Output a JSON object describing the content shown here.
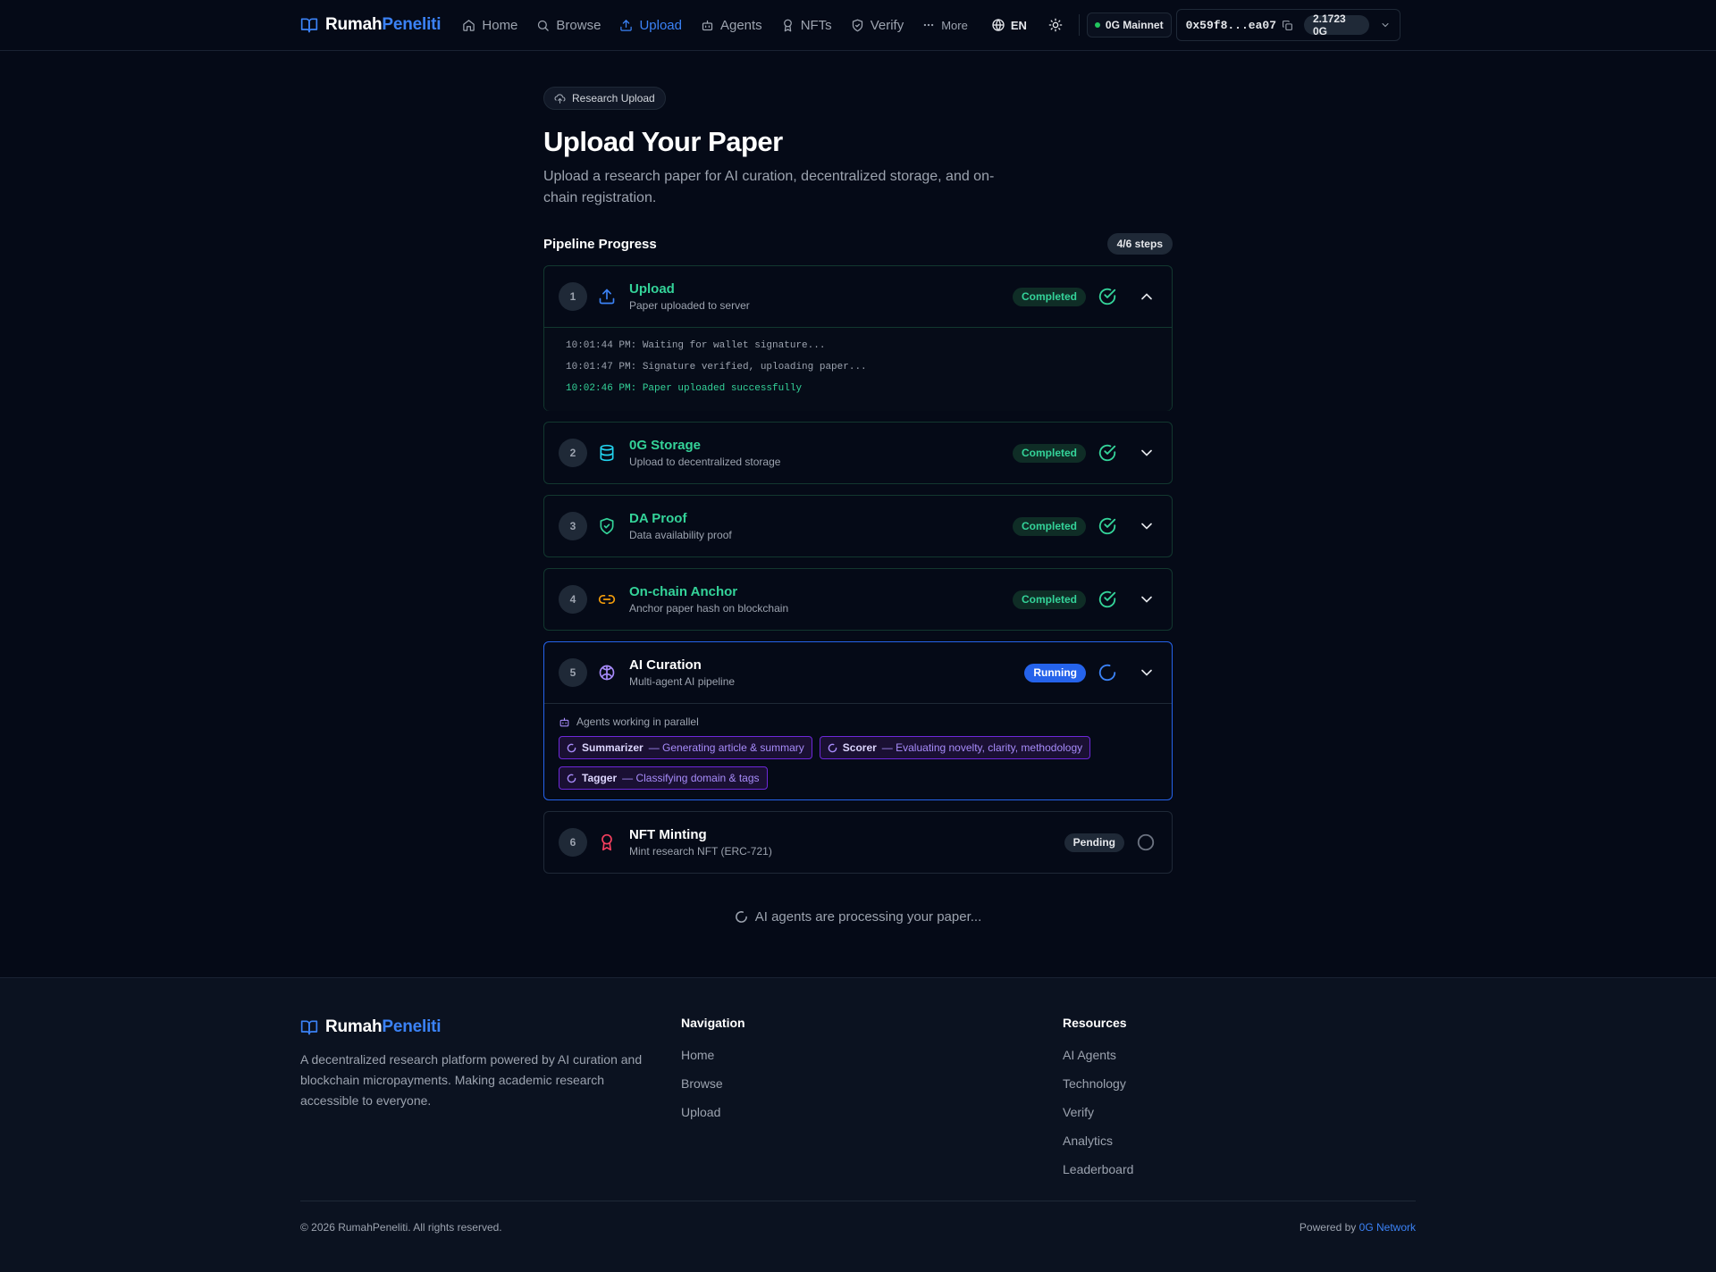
{
  "nav": {
    "brand_a": "Rumah",
    "brand_b": "Peneliti",
    "links": [
      {
        "label": "Home",
        "icon": "home-icon"
      },
      {
        "label": "Browse",
        "icon": "search-icon"
      },
      {
        "label": "Upload",
        "icon": "upload-icon",
        "active": true
      },
      {
        "label": "Agents",
        "icon": "bot-icon"
      },
      {
        "label": "NFTs",
        "icon": "award-icon"
      },
      {
        "label": "Verify",
        "icon": "shield-check-icon"
      },
      {
        "label": "More",
        "icon": "ellipsis-icon"
      }
    ],
    "language": "EN",
    "network": "0G Mainnet",
    "wallet_address": "0x59f8...ea07",
    "balance": "2.1723 0G"
  },
  "hero": {
    "chip": "Research Upload",
    "title": "Upload Your Paper",
    "subtitle": "Upload a research paper for AI curation, decentralized storage, and on-chain registration."
  },
  "pipeline": {
    "title": "Pipeline Progress",
    "count": "4/6 steps",
    "steps": [
      {
        "num": "1",
        "title": "Upload",
        "desc": "Paper uploaded to server",
        "status": "Completed",
        "icon": "upload-icon",
        "logs": [
          {
            "text": "10:01:44 PM: Waiting for wallet signature..."
          },
          {
            "text": "10:01:47 PM: Signature verified, uploading paper..."
          },
          {
            "text": "10:02:46 PM: Paper uploaded successfully"
          }
        ]
      },
      {
        "num": "2",
        "title": "0G Storage",
        "desc": "Upload to decentralized storage",
        "status": "Completed",
        "icon": "database-icon"
      },
      {
        "num": "3",
        "title": "DA Proof",
        "desc": "Data availability proof",
        "status": "Completed",
        "icon": "shield-check-icon"
      },
      {
        "num": "4",
        "title": "On-chain Anchor",
        "desc": "Anchor paper hash on blockchain",
        "status": "Completed",
        "icon": "link-icon"
      },
      {
        "num": "5",
        "title": "AI Curation",
        "desc": "Multi-agent AI pipeline",
        "status": "Running",
        "icon": "brain-icon",
        "agents_label": "Agents working in parallel",
        "agents": [
          {
            "name": "Summarizer",
            "task": "— Generating article & summary"
          },
          {
            "name": "Scorer",
            "task": "— Evaluating novelty, clarity, methodology"
          },
          {
            "name": "Tagger",
            "task": "— Classifying domain & tags"
          }
        ]
      },
      {
        "num": "6",
        "title": "NFT Minting",
        "desc": "Mint research NFT (ERC-721)",
        "status": "Pending",
        "icon": "award-icon"
      }
    ],
    "processing": "AI agents are processing your paper..."
  },
  "footer": {
    "brand_a": "Rumah",
    "brand_b": "Peneliti",
    "description": "A decentralized research platform powered by AI curation and blockchain micropayments. Making academic research accessible to everyone.",
    "nav_title": "Navigation",
    "nav_links": [
      "Home",
      "Browse",
      "Upload"
    ],
    "res_title": "Resources",
    "res_links": [
      "AI Agents",
      "Technology",
      "Verify",
      "Analytics",
      "Leaderboard"
    ],
    "copyright": "© 2026 RumahPeneliti. All rights reserved.",
    "powered_prefix": "Powered by",
    "powered_link": "0G Network"
  },
  "colors": {
    "background": "#050a17",
    "accent": "#3b82f6",
    "success": "#34d399",
    "running": "#2563eb",
    "agent": "#a78bfa"
  }
}
